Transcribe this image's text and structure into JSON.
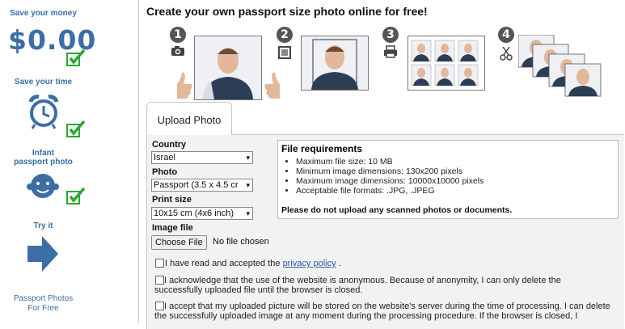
{
  "sidebar": {
    "save_money": "Save your money",
    "price": "$0.00",
    "save_time": "Save your time",
    "infant_line1": "Infant",
    "infant_line2": "passport photo",
    "try_it": "Try it",
    "footer_line1": "Passport Photos",
    "footer_line2": "For Free"
  },
  "header": {
    "title": "Create your own passport size photo online for free!"
  },
  "steps": [
    "1",
    "2",
    "3",
    "4"
  ],
  "tabs": {
    "upload": "Upload Photo"
  },
  "form": {
    "country_label": "Country",
    "country_value": "Israel",
    "photo_label": "Photo",
    "photo_value": "Passport (3.5 x 4.5 cr",
    "print_label": "Print size",
    "print_value": "10x15 cm (4x6 inch)",
    "image_label": "Image file",
    "choose_file": "Choose File",
    "no_file": "No file chosen"
  },
  "requirements": {
    "title": "File requirements",
    "items": [
      "Maximum file size: 10 MB",
      "Minimum image dimensions: 130x200 pixels",
      "Maximum image dimensions: 10000x10000 pixels",
      "Acceptable file formats: .JPG, .JPEG"
    ],
    "warning": "Please do not upload any scanned photos or documents."
  },
  "agreements": {
    "privacy_prefix": "I have read and accepted the ",
    "privacy_link": "privacy policy",
    "privacy_suffix": " .",
    "anon": "I acknowledge that the use of the website is anonymous. Because of anonymity, I can only delete the successfully uploaded file until the browser is closed.",
    "storage": "I accept that my uploaded picture will be stored on the website's server during the time of processing. I can delete the successfully uploaded image at any moment during the processing procedure. If the browser is closed, I"
  },
  "colors": {
    "accent": "#3b6ea5",
    "check": "#2aa830",
    "link": "#2a5aa5"
  }
}
